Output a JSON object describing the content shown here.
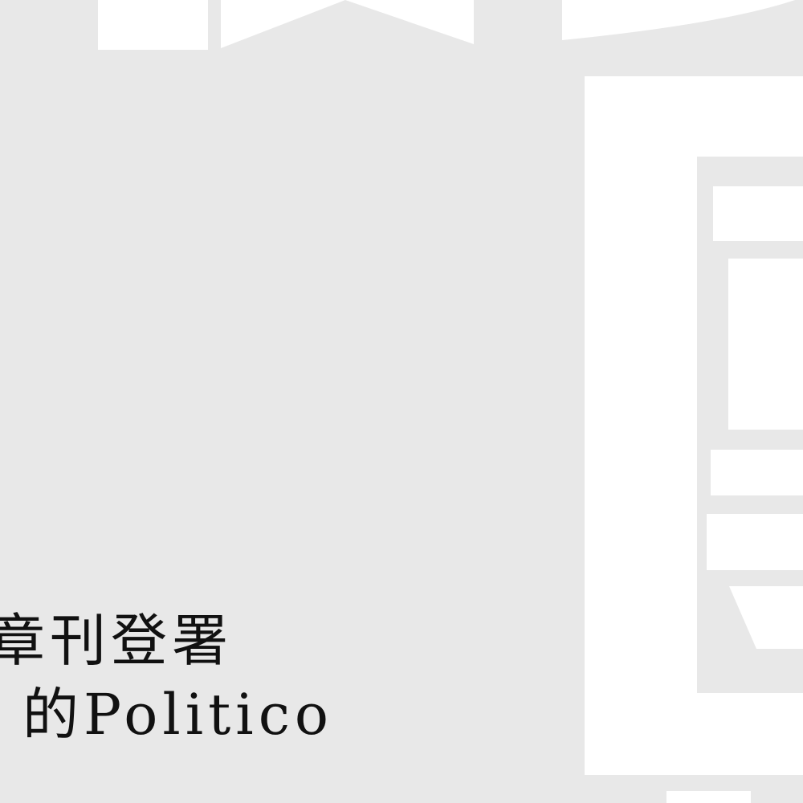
{
  "caption": {
    "line_1": "報章刊登署",
    "line_2": "的Politico"
  },
  "colors": {
    "background": "#e8e8e8",
    "shapes": "#ffffff",
    "text": "#111111"
  }
}
